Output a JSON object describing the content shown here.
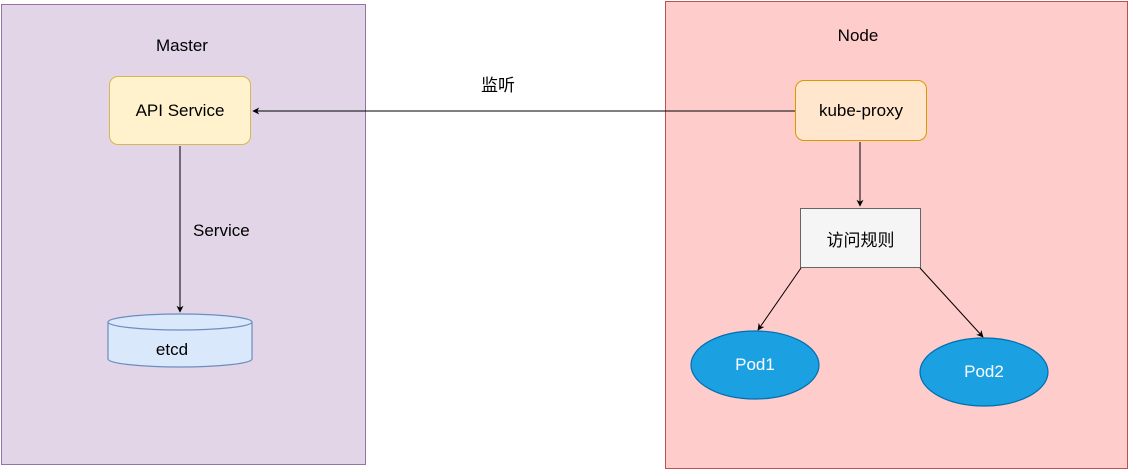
{
  "master": {
    "title": "Master",
    "api_service": "API Service",
    "edge_label": "Service",
    "etcd": "etcd"
  },
  "node": {
    "title": "Node",
    "kube_proxy": "kube-proxy",
    "access_rules": "访问规则",
    "pod1": "Pod1",
    "pod2": "Pod2"
  },
  "edges": {
    "watch_label": "监听"
  },
  "colors": {
    "master_fill": "#e1d5e7",
    "master_stroke": "#9673a6",
    "node_fill": "#ffcccc",
    "node_stroke": "#b85450",
    "api_fill": "#fff2cc",
    "proxy_fill": "#ffe6cc",
    "etcd_fill": "#dae8fc",
    "pod_fill": "#1ba1e2"
  }
}
